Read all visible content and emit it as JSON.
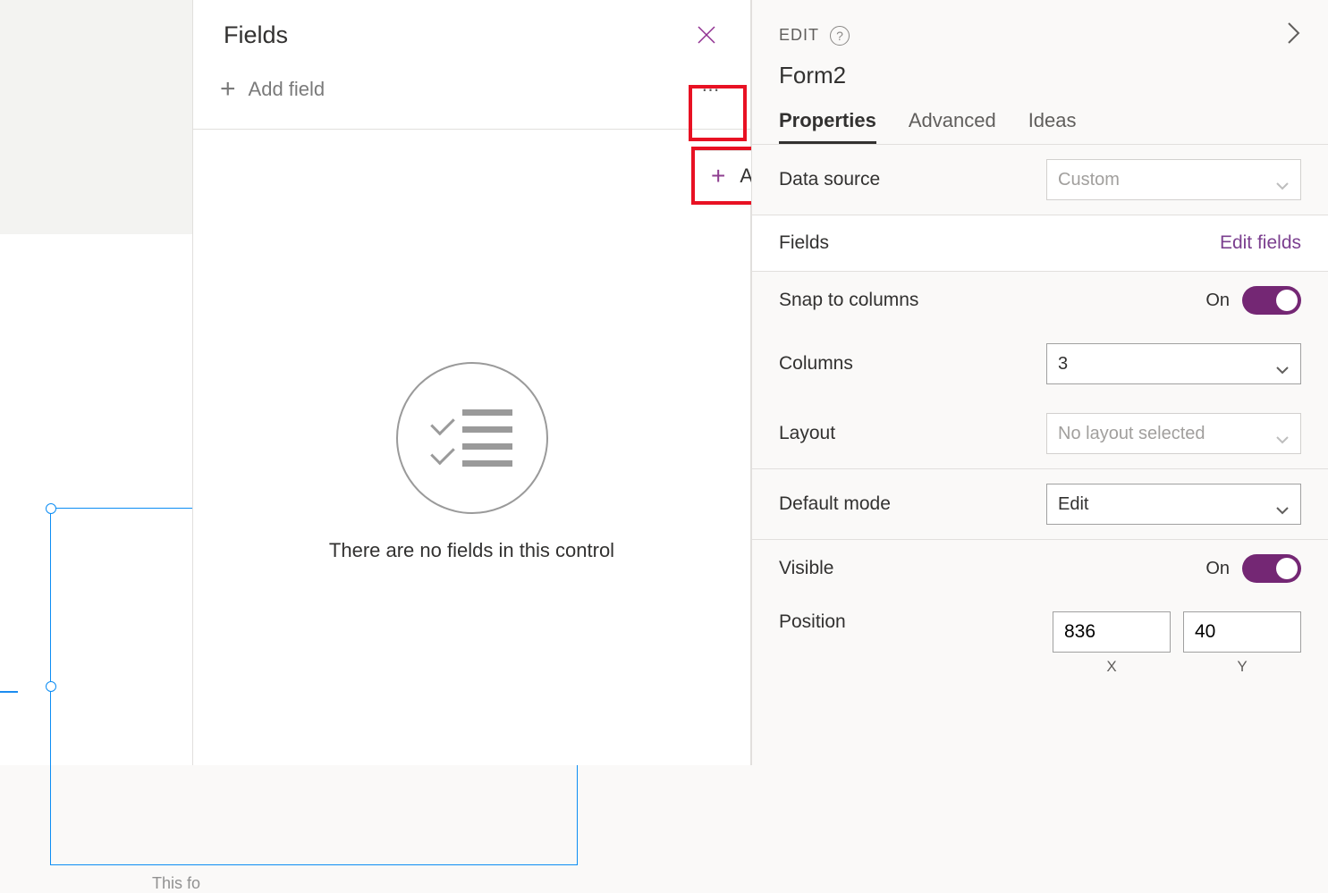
{
  "canvas": {
    "hint_text": "This fo"
  },
  "fields_panel": {
    "title": "Fields",
    "add_field_label": "Add field",
    "empty_state_text": "There are no fields in this control"
  },
  "popup": {
    "add_custom_card": "Add a custom card"
  },
  "props": {
    "edit_label": "EDIT",
    "form_name": "Form2",
    "tabs": {
      "properties": "Properties",
      "advanced": "Advanced",
      "ideas": "Ideas"
    },
    "data_source_label": "Data source",
    "data_source_value": "Custom",
    "fields_label": "Fields",
    "edit_fields_link": "Edit fields",
    "snap_to_columns_label": "Snap to columns",
    "snap_on_label": "On",
    "columns_label": "Columns",
    "columns_value": "3",
    "layout_label": "Layout",
    "layout_value": "No layout selected",
    "default_mode_label": "Default mode",
    "default_mode_value": "Edit",
    "visible_label": "Visible",
    "visible_on_label": "On",
    "position_label": "Position",
    "position_x": "836",
    "position_y": "40",
    "position_x_label": "X",
    "position_y_label": "Y"
  }
}
